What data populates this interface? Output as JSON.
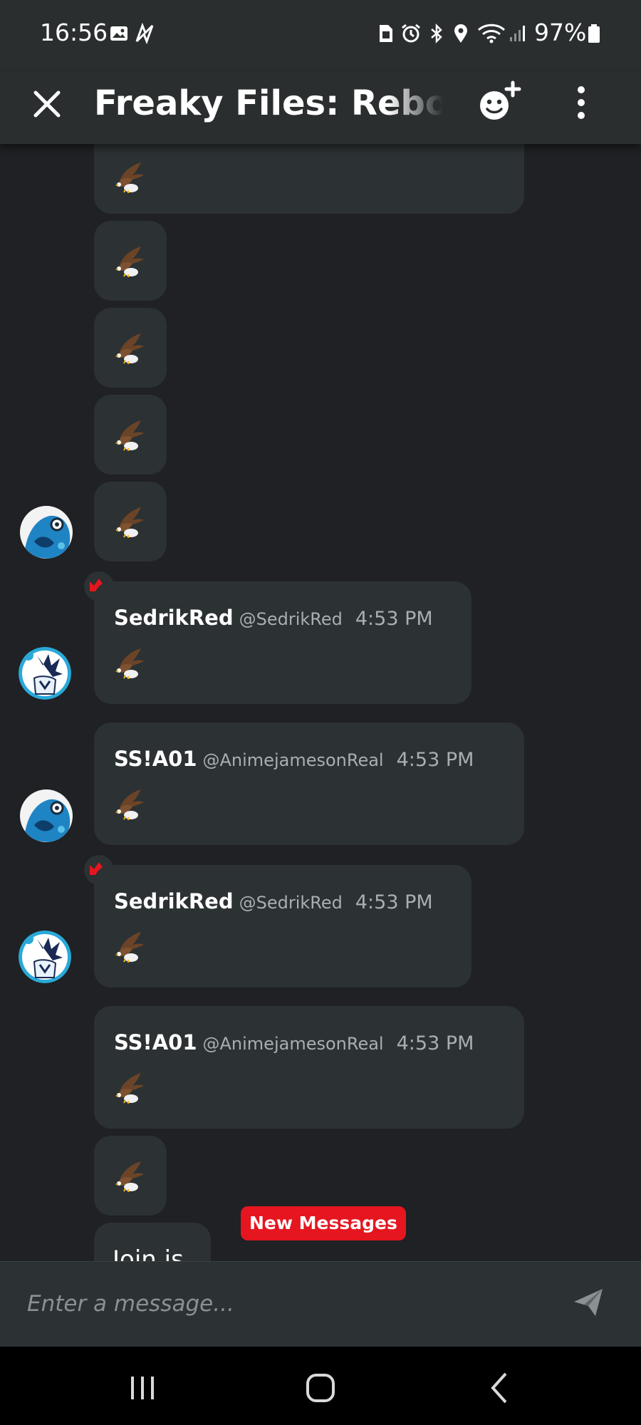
{
  "status_bar": {
    "time": "16:56",
    "battery": "97%",
    "icons": [
      "gallery-icon",
      "messenger-icon",
      "sim-icon",
      "alarm-icon",
      "bluetooth-icon",
      "location-icon",
      "wifi-icon",
      "signal-icon",
      "battery-icon"
    ]
  },
  "app_bar": {
    "title": "Freaky Files: Rebooted",
    "close_icon": "close-icon",
    "add_icon": "add-reaction-icon",
    "menu_icon": "more-vert-icon"
  },
  "messages": [
    {
      "author": "SS!A01",
      "emoji": "eagle",
      "kind": "continuation"
    },
    {
      "author": "SS!A01",
      "emoji": "eagle",
      "kind": "continuation"
    },
    {
      "author": "SS!A01",
      "emoji": "eagle",
      "kind": "continuation"
    },
    {
      "author": "SS!A01",
      "emoji": "eagle",
      "kind": "continuation"
    },
    {
      "author": "SS!A01",
      "emoji": "eagle",
      "kind": "continuation"
    },
    {
      "author": "SedrikRed",
      "handle": "@SedrikRed",
      "time": "4:53 PM",
      "emoji": "eagle",
      "owner": true
    },
    {
      "author": "SS!A01",
      "handle": "@AnimejamesonReal",
      "time": "4:53 PM",
      "emoji": "eagle"
    },
    {
      "author": "SedrikRed",
      "handle": "@SedrikRed",
      "time": "4:53 PM",
      "emoji": "eagle",
      "owner": true
    },
    {
      "author": "SS!A01",
      "handle": "@AnimejamesonReal",
      "time": "4:53 PM",
      "emoji": "eagle"
    },
    {
      "author": "SS!A01",
      "emoji": "eagle",
      "kind": "continuation"
    },
    {
      "author": "SS!A01",
      "text": "Join is",
      "kind": "continuation"
    }
  ],
  "new_messages_label": "New Messages",
  "composer": {
    "placeholder": "Enter a message...",
    "send_icon": "send-icon"
  },
  "nav_bar": {
    "buttons": [
      "recents-icon",
      "home-icon",
      "back-icon"
    ]
  },
  "colors": {
    "background": "#1f2124",
    "bar": "#2a2e2f",
    "bubble": "#2c3133",
    "muted_text": "#a9aeb1",
    "accent_red": "#e5161f"
  }
}
